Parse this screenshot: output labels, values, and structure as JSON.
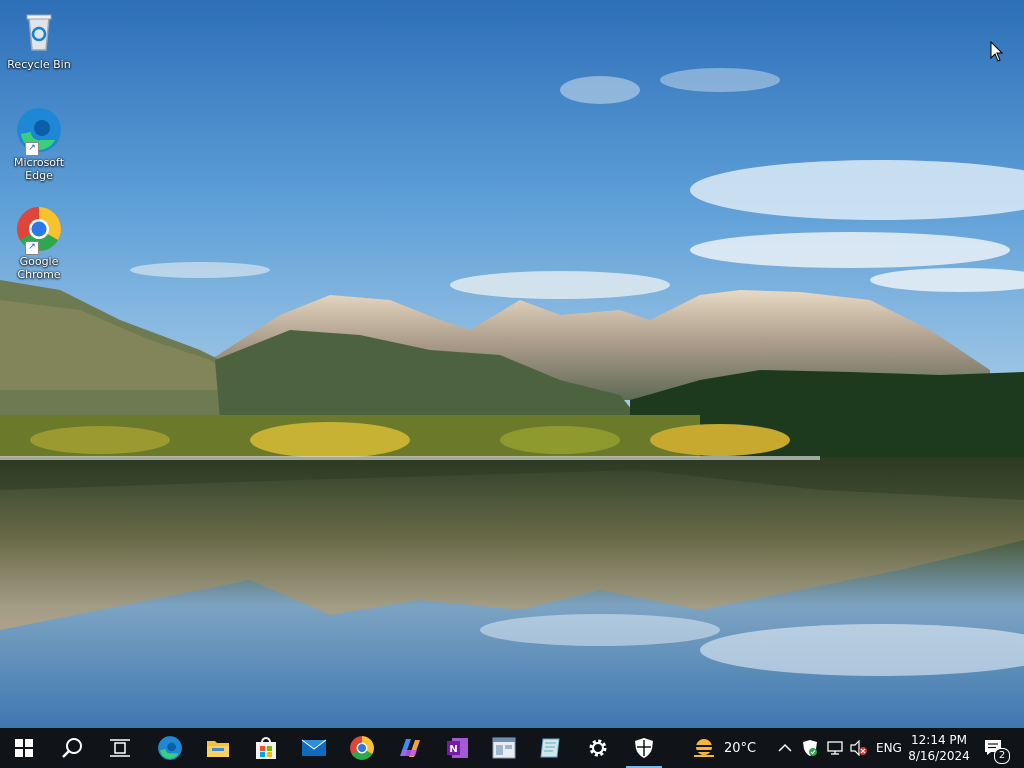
{
  "desktop": {
    "icons": [
      {
        "label": "Recycle Bin",
        "icon": "recycle-bin-icon"
      },
      {
        "label": "Microsoft Edge",
        "icon": "edge-icon"
      },
      {
        "label": "Google Chrome",
        "icon": "chrome-icon"
      }
    ]
  },
  "taskbar": {
    "apps": [
      {
        "name": "start-button",
        "icon": "windows-logo-icon"
      },
      {
        "name": "search-button",
        "icon": "search-icon"
      },
      {
        "name": "task-view-button",
        "icon": "task-view-icon"
      },
      {
        "name": "edge-taskbar",
        "icon": "edge-icon"
      },
      {
        "name": "file-explorer-taskbar",
        "icon": "folder-icon"
      },
      {
        "name": "store-taskbar",
        "icon": "store-icon"
      },
      {
        "name": "mail-taskbar",
        "icon": "mail-icon"
      },
      {
        "name": "chrome-taskbar",
        "icon": "chrome-icon"
      },
      {
        "name": "copilot-taskbar",
        "icon": "copilot-icon"
      },
      {
        "name": "onenote-taskbar",
        "icon": "onenote-icon"
      },
      {
        "name": "app-window-taskbar",
        "icon": "window-icon"
      },
      {
        "name": "app-taskbar-2",
        "icon": "document-icon"
      },
      {
        "name": "settings-taskbar",
        "icon": "gear-icon"
      },
      {
        "name": "security-taskbar",
        "icon": "shield-icon",
        "active": true
      }
    ],
    "weather": {
      "temp": "20°C",
      "icon": "sun-haze-icon"
    },
    "tray": {
      "language": "ENG",
      "time": "12:14 PM",
      "date": "8/16/2024",
      "notifications": "2"
    }
  }
}
